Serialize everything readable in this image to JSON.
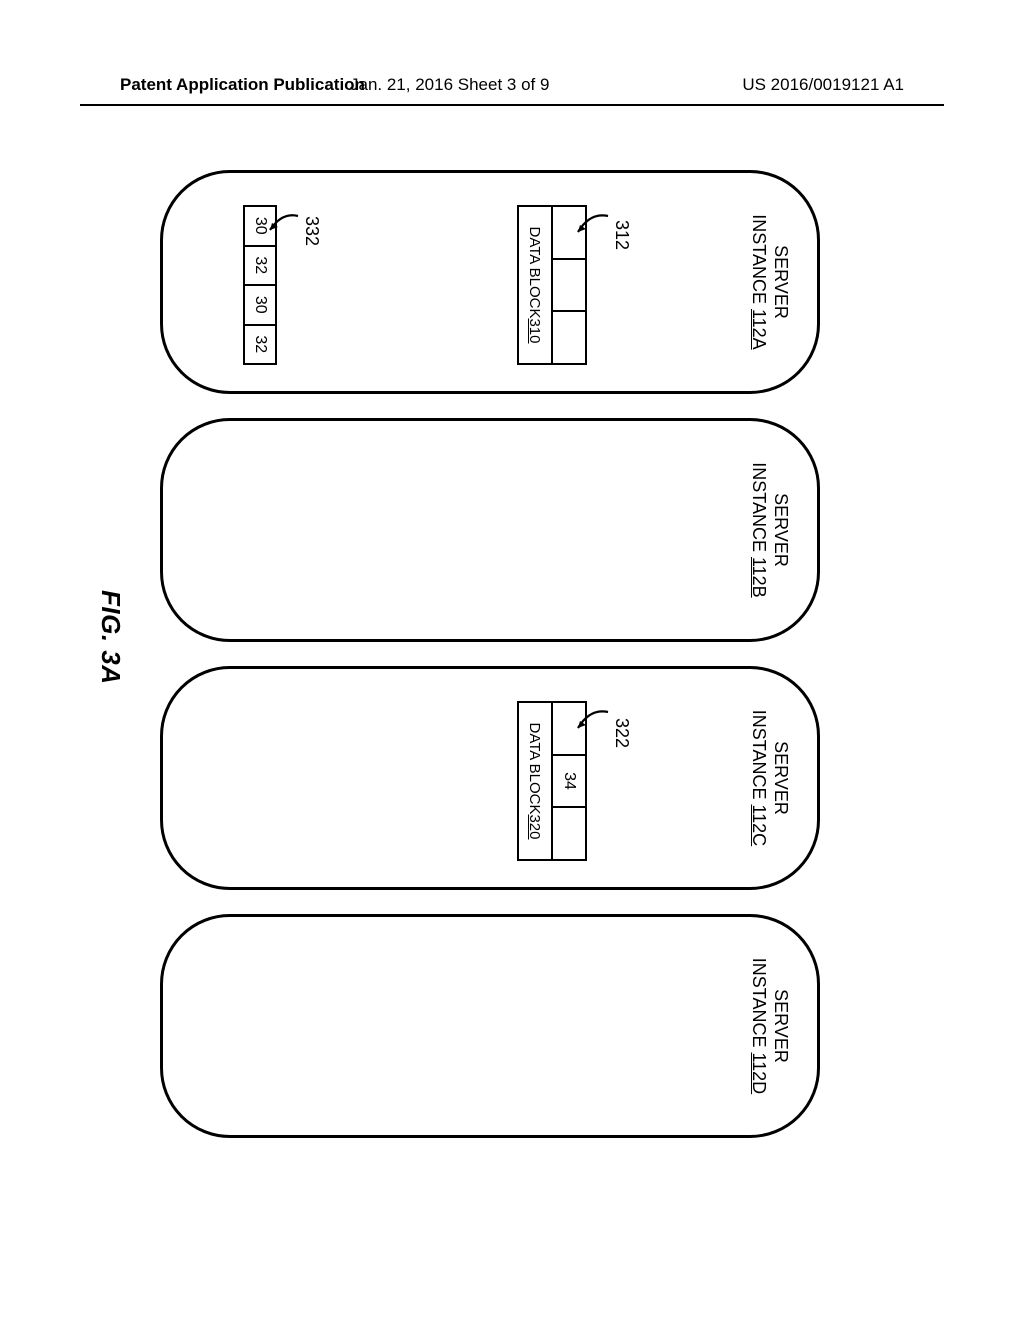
{
  "header": {
    "left": "Patent Application Publication",
    "center": "Jan. 21, 2016  Sheet 3 of 9",
    "right": "US 2016/0019121 A1"
  },
  "diagram": {
    "servers": {
      "A": {
        "line1": "SERVER",
        "line2_prefix": "INSTANCE ",
        "line2_num": "112A"
      },
      "B": {
        "line1": "SERVER",
        "line2_prefix": "INSTANCE ",
        "line2_num": "112B"
      },
      "C": {
        "line1": "SERVER",
        "line2_prefix": "INSTANCE ",
        "line2_num": "112C"
      },
      "D": {
        "line1": "SERVER",
        "line2_prefix": "INSTANCE ",
        "line2_num": "112D"
      }
    },
    "dataBlockA": {
      "ref": "312",
      "cells": [
        "",
        "",
        ""
      ],
      "label_prefix": "DATA BLOCK ",
      "label_num": "310"
    },
    "dataBlockC": {
      "ref": "322",
      "cells": [
        "",
        "34",
        ""
      ],
      "label_prefix": "DATA BLOCK ",
      "label_num": "320"
    },
    "stripA": {
      "ref": "332",
      "cells": [
        "30",
        "32",
        "30",
        "32"
      ]
    },
    "figureCaption": "FIG. 3A"
  }
}
